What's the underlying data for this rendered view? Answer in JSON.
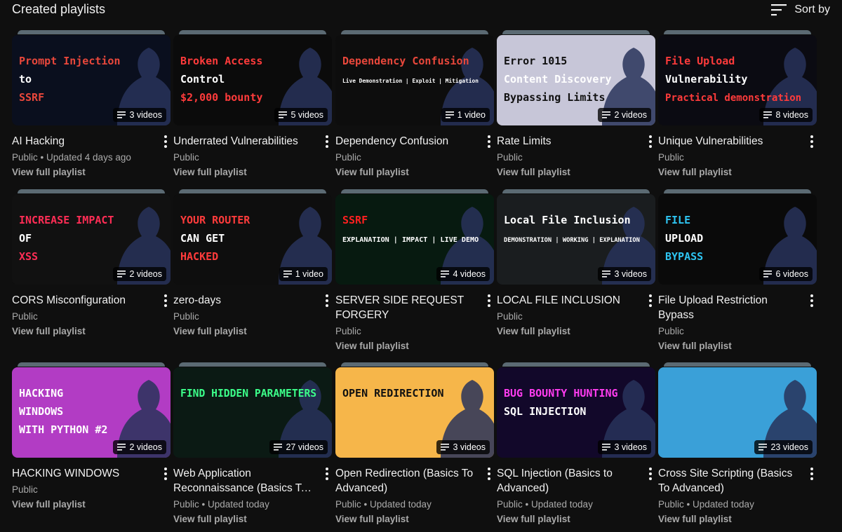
{
  "header": {
    "title": "Created playlists",
    "sort_label": "Sort by"
  },
  "playlists": [
    {
      "title": "AI Hacking",
      "meta": "Public • Updated 4 days ago",
      "count": "3 videos",
      "link": "View full playlist",
      "thumb_lines": [
        "Prompt Injection",
        "to",
        "SSRF"
      ],
      "thumb_bg": "#0a0f1e",
      "thumb_accent": "#e8473b"
    },
    {
      "title": "Underrated Vulnerabilities",
      "meta": "Public",
      "count": "5 videos",
      "link": "View full playlist",
      "thumb_lines": [
        "Broken Access",
        "Control",
        "$2,000 bounty"
      ],
      "thumb_bg": "#0b0b0b",
      "thumb_accent": "#ff3b3b"
    },
    {
      "title": "Dependency Confusion",
      "meta": "Public",
      "count": "1 video",
      "link": "View full playlist",
      "thumb_lines": [
        "Dependency Confusion",
        "Live Demonstration | Exploit | Mitigation",
        ""
      ],
      "thumb_bg": "#0d0d0d",
      "thumb_accent": "#e8473b"
    },
    {
      "title": "Rate Limits",
      "meta": "Public",
      "count": "2 videos",
      "link": "View full playlist",
      "thumb_lines": [
        "Error 1015",
        "Content Discovery",
        "Bypassing Limits"
      ],
      "thumb_bg": "#c7c6d8",
      "thumb_accent": "#111111"
    },
    {
      "title": "Unique Vulnerabilities",
      "meta": "Public",
      "count": "8 videos",
      "link": "View full playlist",
      "thumb_lines": [
        "File Upload",
        "Vulnerability",
        "Practical demonstration"
      ],
      "thumb_bg": "#0b0b12",
      "thumb_accent": "#ff3b3b"
    },
    {
      "title": "CORS Misconfiguration",
      "meta": "Public",
      "count": "2 videos",
      "link": "View full playlist",
      "thumb_lines": [
        "INCREASE IMPACT",
        "OF",
        "XSS"
      ],
      "thumb_bg": "#111111",
      "thumb_accent": "#ff2d55"
    },
    {
      "title": "zero-days",
      "meta": "Public",
      "count": "1 video",
      "link": "View full playlist",
      "thumb_lines": [
        "YOUR ROUTER",
        "CAN GET",
        "HACKED"
      ],
      "thumb_bg": "#0e0e0e",
      "thumb_accent": "#ff3b3b"
    },
    {
      "title": "SERVER SIDE REQUEST FORGERY",
      "meta": "Public",
      "count": "4 videos",
      "link": "View full playlist",
      "thumb_lines": [
        "SSRF",
        "EXPLANATION | IMPACT | LIVE DEMO",
        ""
      ],
      "thumb_bg": "#071a10",
      "thumb_accent": "#ff2020"
    },
    {
      "title": "LOCAL FILE INCLUSION",
      "meta": "Public",
      "count": "3 videos",
      "link": "View full playlist",
      "thumb_lines": [
        "Local File Inclusion",
        "DEMONSTRATION | WORKING | EXPLANATION",
        ""
      ],
      "thumb_bg": "#1a1d1f",
      "thumb_accent": "#ffffff"
    },
    {
      "title": "File Upload Restriction Bypass",
      "meta": "Public",
      "count": "6 videos",
      "link": "View full playlist",
      "thumb_lines": [
        "FILE",
        "UPLOAD",
        "BYPASS"
      ],
      "thumb_bg": "#0a0a0a",
      "thumb_accent": "#2ec4f1"
    },
    {
      "title": "HACKING WINDOWS",
      "meta": "Public",
      "count": "2 videos",
      "link": "View full playlist",
      "thumb_lines": [
        "HACKING",
        "WINDOWS",
        "WITH PYTHON #2"
      ],
      "thumb_bg": "#b23cc4",
      "thumb_accent": "#ffffff"
    },
    {
      "title": "Web Application Reconnaissance (Basics To Advanced)",
      "meta": "Public • Updated today",
      "count": "27 videos",
      "link": "View full playlist",
      "thumb_lines": [
        "FIND HIDDEN PARAMETERS",
        "",
        ""
      ],
      "thumb_bg": "#0b1a14",
      "thumb_accent": "#3cff8a"
    },
    {
      "title": "Open Redirection (Basics To Advanced)",
      "meta": "Public • Updated today",
      "count": "3 videos",
      "link": "View full playlist",
      "thumb_lines": [
        "OPEN REDIRECTION",
        "",
        ""
      ],
      "thumb_bg": "#f6b64a",
      "thumb_accent": "#111111"
    },
    {
      "title": "SQL Injection (Basics to Advanced)",
      "meta": "Public • Updated today",
      "count": "3 videos",
      "link": "View full playlist",
      "thumb_lines": [
        "BUG BOUNTY HUNTING",
        "SQL INJECTION",
        ""
      ],
      "thumb_bg": "#12082a",
      "thumb_accent": "#ff3cf0"
    },
    {
      "title": "Cross Site Scripting (Basics To Advanced)",
      "meta": "Public • Updated today",
      "count": "23 videos",
      "link": "View full playlist",
      "thumb_lines": [
        "",
        "",
        ""
      ],
      "thumb_bg": "#3aa0d8",
      "thumb_accent": "#ffffff"
    }
  ]
}
